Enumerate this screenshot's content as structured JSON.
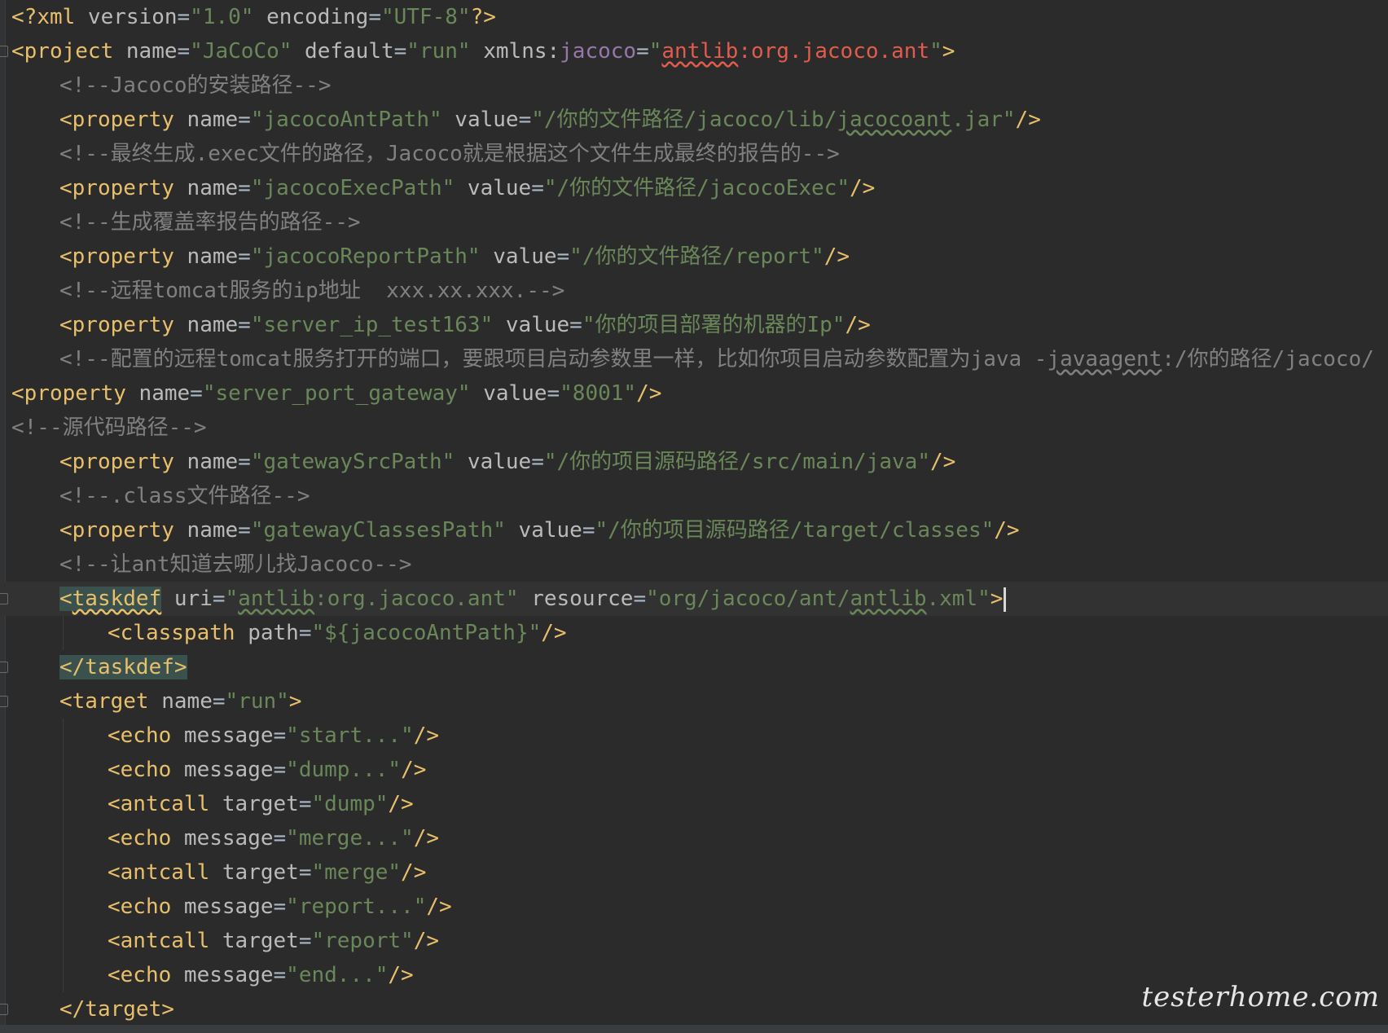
{
  "editor": {
    "language": "XML",
    "current_line": 18,
    "colors": {
      "background": "#2b2b2b",
      "tag": "#e8bf6a",
      "attribute": "#bababa",
      "string": "#6a8759",
      "punctuation": "#a9b7c6",
      "comment": "#808080",
      "namespace": "#9876aa",
      "error": "#e25b4b",
      "tag_match_bg": "#3b514d"
    },
    "lines": [
      {
        "indent": 0,
        "tokens": [
          {
            "t": "<?",
            "c": "tag"
          },
          {
            "t": "xml",
            "c": "tag"
          },
          {
            "t": " version",
            "c": "attr"
          },
          {
            "t": "=",
            "c": "punct"
          },
          {
            "t": "\"1.0\"",
            "c": "str"
          },
          {
            "t": " encoding",
            "c": "attr"
          },
          {
            "t": "=",
            "c": "punct"
          },
          {
            "t": "\"UTF-8\"",
            "c": "str"
          },
          {
            "t": "?>",
            "c": "tag"
          }
        ]
      },
      {
        "indent": 0,
        "fold": true,
        "tokens": [
          {
            "t": "<project",
            "c": "tag"
          },
          {
            "t": " name",
            "c": "attr"
          },
          {
            "t": "=",
            "c": "punct"
          },
          {
            "t": "\"JaCoCo\"",
            "c": "str"
          },
          {
            "t": " default",
            "c": "attr"
          },
          {
            "t": "=",
            "c": "punct"
          },
          {
            "t": "\"run\"",
            "c": "str"
          },
          {
            "t": " xmlns:",
            "c": "attr"
          },
          {
            "t": "jacoco",
            "c": "ns"
          },
          {
            "t": "=",
            "c": "punct"
          },
          {
            "t": "\"",
            "c": "str"
          },
          {
            "t": "antlib",
            "c": "err_u"
          },
          {
            "t": ":org.jacoco.ant",
            "c": "err"
          },
          {
            "t": "\"",
            "c": "str"
          },
          {
            "t": ">",
            "c": "tag"
          }
        ]
      },
      {
        "indent": 1,
        "tokens": [
          {
            "t": "<!--Jacoco的安装路径-->",
            "c": "comment"
          }
        ]
      },
      {
        "indent": 1,
        "tokens": [
          {
            "t": "<property",
            "c": "tag"
          },
          {
            "t": " name",
            "c": "attr"
          },
          {
            "t": "=",
            "c": "punct"
          },
          {
            "t": "\"jacocoAntPath\"",
            "c": "str"
          },
          {
            "t": " value",
            "c": "attr"
          },
          {
            "t": "=",
            "c": "punct"
          },
          {
            "t": "\"/你的文件路径/jacoco/lib/",
            "c": "str"
          },
          {
            "t": "jacocoant",
            "c": "str_u"
          },
          {
            "t": ".jar\"",
            "c": "str"
          },
          {
            "t": "/>",
            "c": "tag"
          }
        ]
      },
      {
        "indent": 1,
        "tokens": [
          {
            "t": "<!--最终生成.exec文件的路径，Jacoco就是根据这个文件生成最终的报告的-->",
            "c": "comment"
          }
        ]
      },
      {
        "indent": 1,
        "tokens": [
          {
            "t": "<property",
            "c": "tag"
          },
          {
            "t": " name",
            "c": "attr"
          },
          {
            "t": "=",
            "c": "punct"
          },
          {
            "t": "\"jacocoExecPath\"",
            "c": "str"
          },
          {
            "t": " value",
            "c": "attr"
          },
          {
            "t": "=",
            "c": "punct"
          },
          {
            "t": "\"/你的文件路径/jacocoExec\"",
            "c": "str"
          },
          {
            "t": "/>",
            "c": "tag"
          }
        ]
      },
      {
        "indent": 1,
        "tokens": [
          {
            "t": "<!--生成覆盖率报告的路径-->",
            "c": "comment"
          }
        ]
      },
      {
        "indent": 1,
        "tokens": [
          {
            "t": "<property",
            "c": "tag"
          },
          {
            "t": " name",
            "c": "attr"
          },
          {
            "t": "=",
            "c": "punct"
          },
          {
            "t": "\"jacocoReportPath\"",
            "c": "str"
          },
          {
            "t": " value",
            "c": "attr"
          },
          {
            "t": "=",
            "c": "punct"
          },
          {
            "t": "\"/你的文件路径/report\"",
            "c": "str"
          },
          {
            "t": "/>",
            "c": "tag"
          }
        ]
      },
      {
        "indent": 1,
        "tokens": [
          {
            "t": "<!--远程tomcat服务的ip地址  xxx.xx.xxx.-->",
            "c": "comment"
          }
        ]
      },
      {
        "indent": 1,
        "tokens": [
          {
            "t": "<property",
            "c": "tag"
          },
          {
            "t": " name",
            "c": "attr"
          },
          {
            "t": "=",
            "c": "punct"
          },
          {
            "t": "\"server_ip_test163\"",
            "c": "str"
          },
          {
            "t": " value",
            "c": "attr"
          },
          {
            "t": "=",
            "c": "punct"
          },
          {
            "t": "\"你的项目部署的机器的Ip\"",
            "c": "str"
          },
          {
            "t": "/>",
            "c": "tag"
          }
        ]
      },
      {
        "indent": 1,
        "tokens": [
          {
            "t": "<!--配置的远程tomcat服务打开的端口，要跟项目启动参数里一样，比如你项目启动参数配置为java -",
            "c": "comment"
          },
          {
            "t": "javaagent",
            "c": "comment_u"
          },
          {
            "t": ":/你的路径/jacoco/",
            "c": "comment"
          }
        ]
      },
      {
        "indent": 0,
        "tokens": [
          {
            "t": "<property",
            "c": "tag"
          },
          {
            "t": " name",
            "c": "attr"
          },
          {
            "t": "=",
            "c": "punct"
          },
          {
            "t": "\"server_port_gateway\"",
            "c": "str"
          },
          {
            "t": " value",
            "c": "attr"
          },
          {
            "t": "=",
            "c": "punct"
          },
          {
            "t": "\"8001\"",
            "c": "str"
          },
          {
            "t": "/>",
            "c": "tag"
          }
        ]
      },
      {
        "indent": 0,
        "tokens": [
          {
            "t": "<!--源代码路径-->",
            "c": "comment"
          }
        ]
      },
      {
        "indent": 1,
        "tokens": [
          {
            "t": "<property",
            "c": "tag"
          },
          {
            "t": " name",
            "c": "attr"
          },
          {
            "t": "=",
            "c": "punct"
          },
          {
            "t": "\"gatewaySrcPath\"",
            "c": "str"
          },
          {
            "t": " value",
            "c": "attr"
          },
          {
            "t": "=",
            "c": "punct"
          },
          {
            "t": "\"/你的项目源码路径/src/main/java\"",
            "c": "str"
          },
          {
            "t": "/>",
            "c": "tag"
          }
        ]
      },
      {
        "indent": 1,
        "tokens": [
          {
            "t": "<!--.class文件路径-->",
            "c": "comment"
          }
        ]
      },
      {
        "indent": 1,
        "tokens": [
          {
            "t": "<property",
            "c": "tag"
          },
          {
            "t": " name",
            "c": "attr"
          },
          {
            "t": "=",
            "c": "punct"
          },
          {
            "t": "\"gatewayClassesPath\"",
            "c": "str"
          },
          {
            "t": " value",
            "c": "attr"
          },
          {
            "t": "=",
            "c": "punct"
          },
          {
            "t": "\"/你的项目源码路径/target/classes\"",
            "c": "str"
          },
          {
            "t": "/>",
            "c": "tag"
          }
        ]
      },
      {
        "indent": 1,
        "tokens": [
          {
            "t": "<!--让ant知道去哪儿找Jacoco-->",
            "c": "comment"
          }
        ]
      },
      {
        "indent": 1,
        "fold": true,
        "current": true,
        "cursor": true,
        "tokens": [
          {
            "t": "<",
            "c": "tag_hl"
          },
          {
            "t": "taskdef",
            "c": "tag_hl_u"
          },
          {
            "t": " uri",
            "c": "attr"
          },
          {
            "t": "=",
            "c": "punct"
          },
          {
            "t": "\"",
            "c": "str"
          },
          {
            "t": "antlib",
            "c": "str_u"
          },
          {
            "t": ":org.jacoco.ant\"",
            "c": "str"
          },
          {
            "t": " resource",
            "c": "attr"
          },
          {
            "t": "=",
            "c": "punct"
          },
          {
            "t": "\"org/jacoco/ant/",
            "c": "str"
          },
          {
            "t": "antlib",
            "c": "str_u"
          },
          {
            "t": ".xml\"",
            "c": "str"
          },
          {
            "t": ">",
            "c": "tag"
          }
        ]
      },
      {
        "indent": 2,
        "tokens": [
          {
            "t": "<classpath",
            "c": "tag"
          },
          {
            "t": " path",
            "c": "attr"
          },
          {
            "t": "=",
            "c": "punct"
          },
          {
            "t": "\"${jacocoAntPath}\"",
            "c": "str"
          },
          {
            "t": "/>",
            "c": "tag"
          }
        ]
      },
      {
        "indent": 1,
        "fold": true,
        "tokens": [
          {
            "t": "</taskdef>",
            "c": "tag_hl"
          }
        ]
      },
      {
        "indent": 1,
        "fold": true,
        "tokens": [
          {
            "t": "<target",
            "c": "tag"
          },
          {
            "t": " name",
            "c": "attr"
          },
          {
            "t": "=",
            "c": "punct"
          },
          {
            "t": "\"run\"",
            "c": "str"
          },
          {
            "t": ">",
            "c": "tag"
          }
        ]
      },
      {
        "indent": 2,
        "tokens": [
          {
            "t": "<echo",
            "c": "tag"
          },
          {
            "t": " message",
            "c": "attr"
          },
          {
            "t": "=",
            "c": "punct"
          },
          {
            "t": "\"start...\"",
            "c": "str"
          },
          {
            "t": "/>",
            "c": "tag"
          }
        ]
      },
      {
        "indent": 2,
        "tokens": [
          {
            "t": "<echo",
            "c": "tag"
          },
          {
            "t": " message",
            "c": "attr"
          },
          {
            "t": "=",
            "c": "punct"
          },
          {
            "t": "\"dump...\"",
            "c": "str"
          },
          {
            "t": "/>",
            "c": "tag"
          }
        ]
      },
      {
        "indent": 2,
        "tokens": [
          {
            "t": "<antcall",
            "c": "tag"
          },
          {
            "t": " target",
            "c": "attr"
          },
          {
            "t": "=",
            "c": "punct"
          },
          {
            "t": "\"dump\"",
            "c": "str"
          },
          {
            "t": "/>",
            "c": "tag"
          }
        ]
      },
      {
        "indent": 2,
        "tokens": [
          {
            "t": "<echo",
            "c": "tag"
          },
          {
            "t": " message",
            "c": "attr"
          },
          {
            "t": "=",
            "c": "punct"
          },
          {
            "t": "\"merge...\"",
            "c": "str"
          },
          {
            "t": "/>",
            "c": "tag"
          }
        ]
      },
      {
        "indent": 2,
        "tokens": [
          {
            "t": "<antcall",
            "c": "tag"
          },
          {
            "t": " target",
            "c": "attr"
          },
          {
            "t": "=",
            "c": "punct"
          },
          {
            "t": "\"merge\"",
            "c": "str"
          },
          {
            "t": "/>",
            "c": "tag"
          }
        ]
      },
      {
        "indent": 2,
        "tokens": [
          {
            "t": "<echo",
            "c": "tag"
          },
          {
            "t": " message",
            "c": "attr"
          },
          {
            "t": "=",
            "c": "punct"
          },
          {
            "t": "\"report...\"",
            "c": "str"
          },
          {
            "t": "/>",
            "c": "tag"
          }
        ]
      },
      {
        "indent": 2,
        "tokens": [
          {
            "t": "<antcall",
            "c": "tag"
          },
          {
            "t": " target",
            "c": "attr"
          },
          {
            "t": "=",
            "c": "punct"
          },
          {
            "t": "\"report\"",
            "c": "str"
          },
          {
            "t": "/>",
            "c": "tag"
          }
        ]
      },
      {
        "indent": 2,
        "tokens": [
          {
            "t": "<echo",
            "c": "tag"
          },
          {
            "t": " message",
            "c": "attr"
          },
          {
            "t": "=",
            "c": "punct"
          },
          {
            "t": "\"end...\"",
            "c": "str"
          },
          {
            "t": "/>",
            "c": "tag"
          }
        ]
      },
      {
        "indent": 1,
        "fold": true,
        "tokens": [
          {
            "t": "</target>",
            "c": "tag"
          }
        ]
      }
    ]
  },
  "watermark": {
    "text": "testerhome.com"
  }
}
